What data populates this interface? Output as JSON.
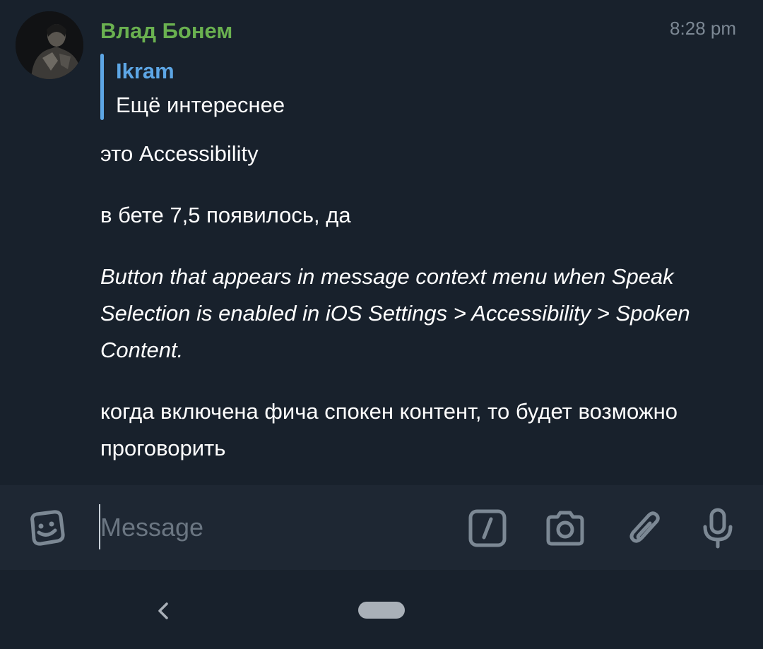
{
  "message": {
    "sender_name": "Влад Бонем",
    "time": "8:28 pm",
    "reply": {
      "author": "Ikram",
      "text": "Ещё интереснее"
    },
    "paragraphs": [
      "это Accessibility",
      "в бете 7,5 появилось, да",
      "Button that appears in message context menu when Speak Selection is enabled in iOS Settings > Accessibility > Spoken Content.",
      "когда включена фича спокен контент, то будет возможно проговорить"
    ]
  },
  "composer": {
    "placeholder": "Message",
    "value": ""
  },
  "icons": {
    "emoji": "sticker-emoji-icon",
    "commands": "bot-commands-icon",
    "camera": "camera-icon",
    "attach": "paperclip-icon",
    "mic": "microphone-icon"
  },
  "colors": {
    "background": "#18212c",
    "input_bar": "#1e2733",
    "sender_name": "#6ab150",
    "reply_accent": "#5da6e5",
    "icon": "#7c8894",
    "timestamp": "#7c8894"
  }
}
